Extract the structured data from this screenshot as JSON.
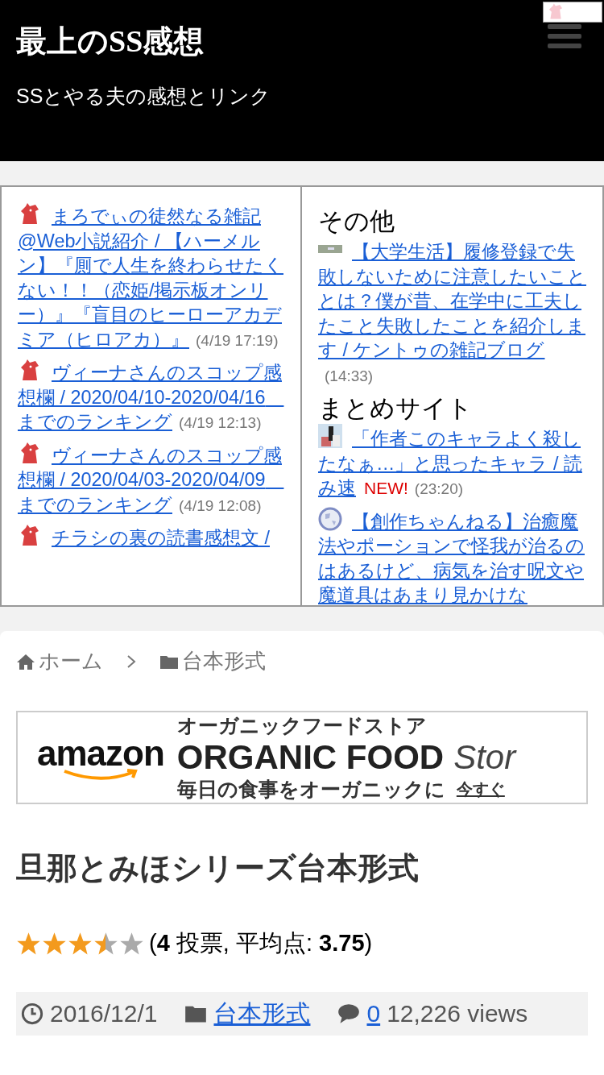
{
  "header": {
    "title": "最上のSS感想",
    "subtitle": "SSとやる夫の感想とリンク"
  },
  "feeds": [
    {
      "sections": [
        {
          "items": [
            {
              "kind": "horse",
              "title": "まろでぃの徒然なる雑記@Web小説紹介 / 【ハーメルン】『厠で人生を終わらせたくない！！（恋姫/掲示板オンリー）』『盲目のヒーローアカデミア（ヒロアカ）』",
              "time": "(4/19 17:19)"
            },
            {
              "kind": "horse",
              "title": "ヴィーナさんのスコップ感想欄 / 2020/04/10-2020/04/16　までのランキング",
              "time": "(4/19 12:13)"
            },
            {
              "kind": "horse",
              "title": "ヴィーナさんのスコップ感想欄 / 2020/04/03-2020/04/09　までのランキング",
              "time": "(4/19 12:08)"
            },
            {
              "kind": "horse",
              "title": "チラシの裏の読書感想文 /"
            }
          ]
        }
      ]
    },
    {
      "sections": [
        {
          "heading": "その他",
          "items": [
            {
              "kind": "strip",
              "title": "【大学生活】履修登録で失敗しないために注意したいこととは？僕が昔、在学中に工夫したこと失敗したことを紹介します / ケントゥの雑記ブログ",
              "time": "(14:33)"
            }
          ]
        },
        {
          "heading": "まとめサイト",
          "items": [
            {
              "kind": "photo",
              "title": "「作者このキャラよく殺したなぁ…」と思ったキャラ / 読み速",
              "badge": "NEW!",
              "time": "(23:20)"
            },
            {
              "kind": "globe",
              "title": "【創作ちゃんねる】治癒魔法やポーションで怪我が治るのはあるけど、病気を治す呪文や魔道具はあまり見かけな"
            }
          ]
        }
      ]
    }
  ],
  "breadcrumb": [
    {
      "kind": "home",
      "label": "ホーム"
    },
    {
      "kind": "folder",
      "label": "台本形式"
    }
  ],
  "ad": {
    "logo": "amazon",
    "line1": "オーガニックフードストア",
    "line2": "ORGANIC FOOD",
    "line2_tail": "Stor",
    "line3": "毎日の食事をオーガニックに",
    "cta": "今すぐ"
  },
  "article": {
    "title": "旦那とみほシリーズ台本形式",
    "rating": {
      "stars": 3.5,
      "text": "(**4** 投票, 平均点: **3.75**)"
    },
    "meta": {
      "date": "2016/12/1",
      "category": "台本形式",
      "comments": "0",
      "views": "12,226 views"
    }
  }
}
